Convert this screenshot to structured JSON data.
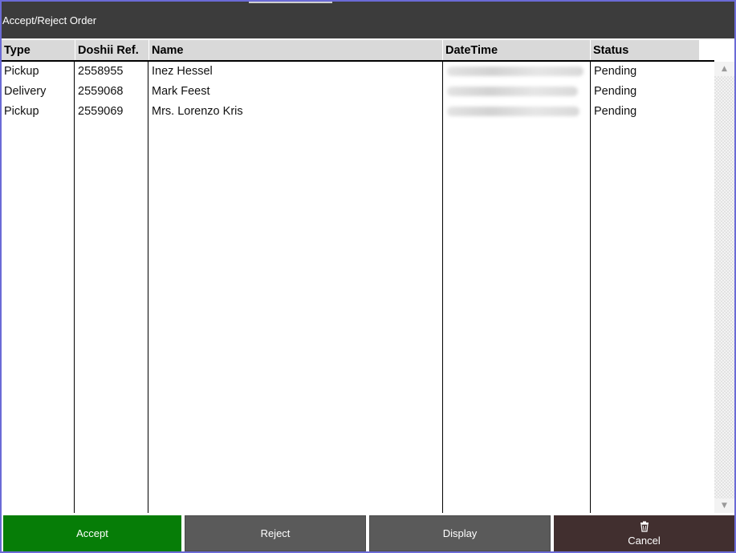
{
  "window": {
    "title": "Accept/Reject Order"
  },
  "table": {
    "columns": [
      "Type",
      "Doshii Ref.",
      "Name",
      "DateTime",
      "Status"
    ],
    "rows": [
      {
        "type": "Pickup",
        "ref": "2558955",
        "name": "Inez Hessel",
        "status": "Pending"
      },
      {
        "type": "Delivery",
        "ref": "2559068",
        "name": "Mark Feest",
        "status": "Pending"
      },
      {
        "type": "Pickup",
        "ref": "2559069",
        "name": "Mrs. Lorenzo Kris",
        "status": "Pending"
      }
    ]
  },
  "footer": {
    "accept_label": "Accept",
    "reject_label": "Reject",
    "display_label": "Display",
    "cancel_label": "Cancel",
    "cancel_icon": "trash-icon"
  },
  "colors": {
    "title_bar": "#3c3c3c",
    "accept": "#067d07",
    "neutral_button": "#5a5a5a",
    "cancel": "#412f2f",
    "window_border": "#6b6bd6"
  }
}
